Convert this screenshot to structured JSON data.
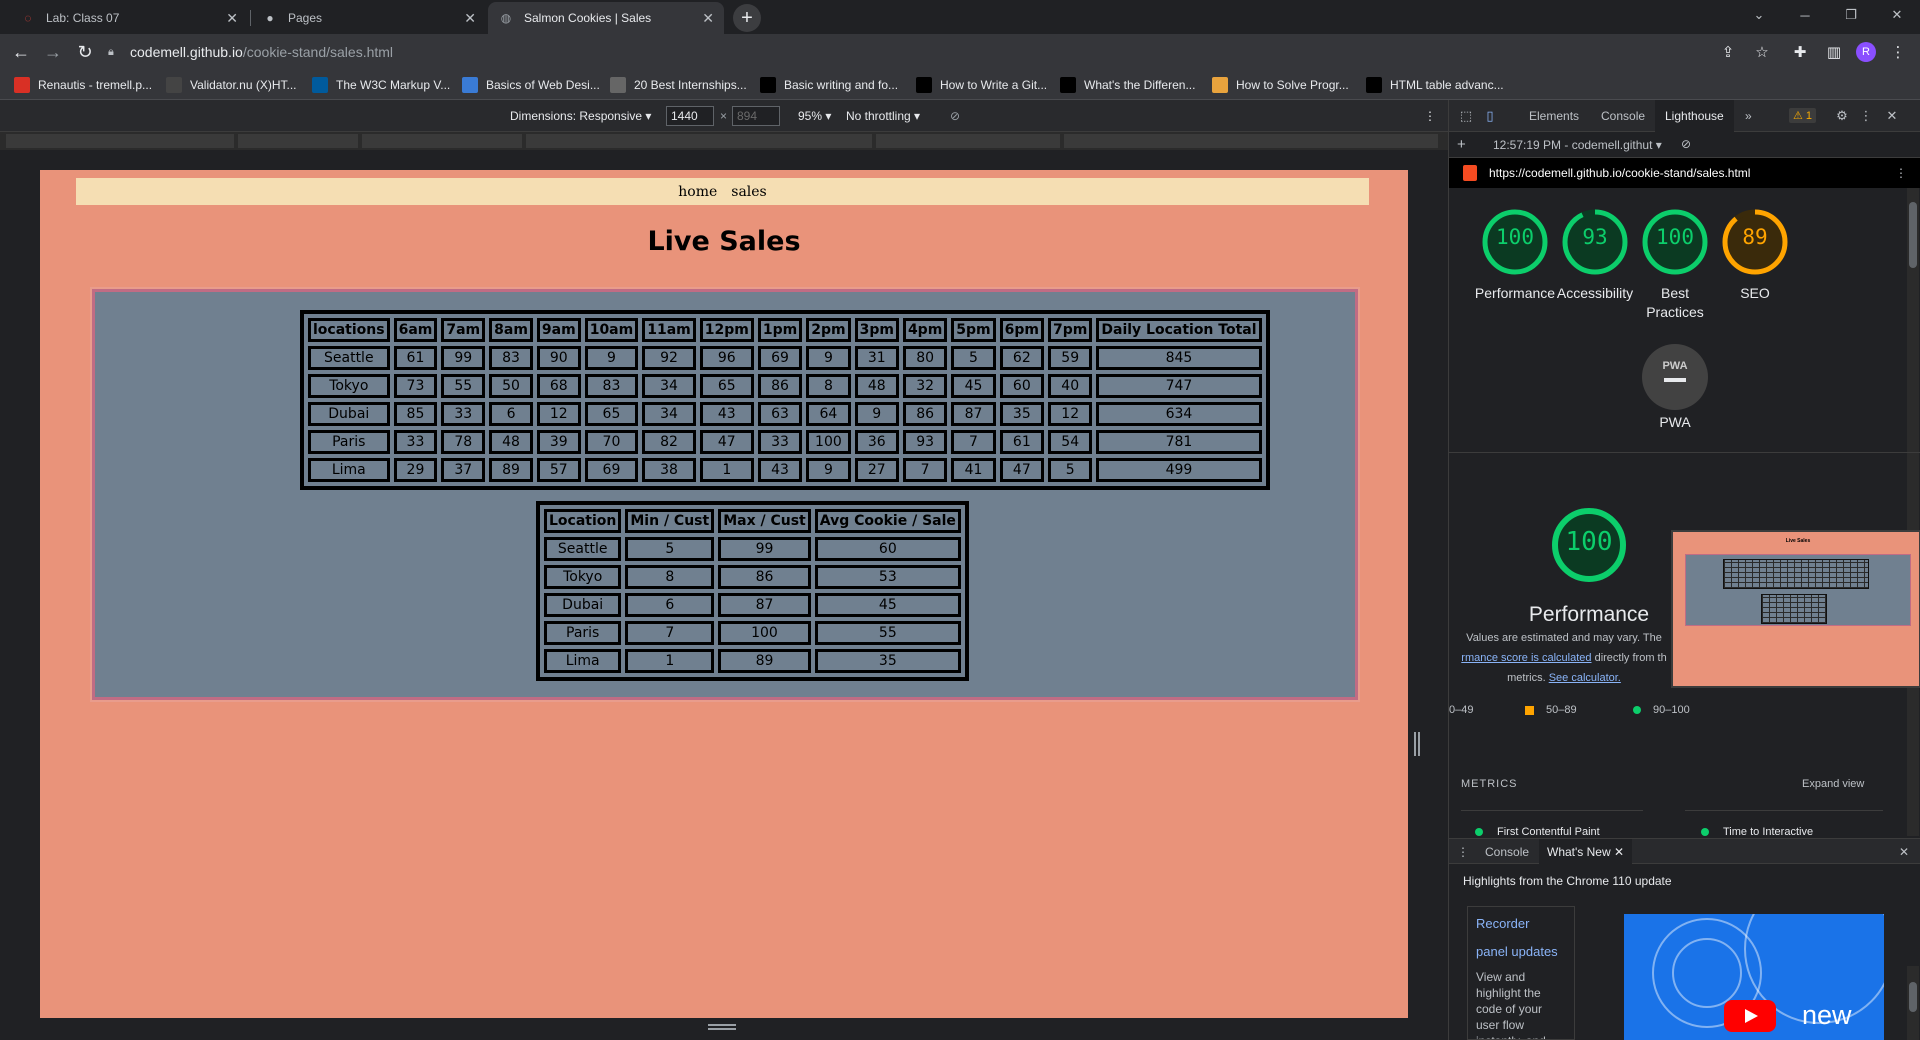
{
  "browser": {
    "tabs": [
      {
        "title": "Lab: Class 07",
        "icon": "codefellows-icon"
      },
      {
        "title": "Pages",
        "icon": "github-icon"
      },
      {
        "title": "Salmon Cookies | Sales",
        "icon": "globe-icon",
        "active": true
      }
    ],
    "url": {
      "host": "codemell.github.io",
      "path": "/cookie-stand/sales.html"
    },
    "profile_initial": "R",
    "bookmarks": [
      {
        "label": "Renautis - tremell.p...",
        "icon": "gmail-icon",
        "color": "#d93025"
      },
      {
        "label": "Validator.nu (X)HT...",
        "icon": "nu-icon",
        "color": "#444444"
      },
      {
        "label": "The W3C Markup V...",
        "icon": "w3c-icon",
        "color": "#005a9c"
      },
      {
        "label": "Basics of Web Desi...",
        "icon": "book-icon",
        "color": "#3a7bd5"
      },
      {
        "label": "20 Best Internships...",
        "icon": "internship-icon",
        "color": "#666666"
      },
      {
        "label": "Basic writing and fo...",
        "icon": "github-icon",
        "color": "#000000"
      },
      {
        "label": "How to Write a Git...",
        "icon": "copyright-icon",
        "color": "#000000"
      },
      {
        "label": "What's the Differen...",
        "icon": "medium-icon",
        "color": "#000000"
      },
      {
        "label": "How to Solve Progr...",
        "icon": "fcc-icon",
        "color": "#e8a33d"
      },
      {
        "label": "HTML table advanc...",
        "icon": "mdn-icon",
        "color": "#000000"
      }
    ]
  },
  "device_toolbar": {
    "dimensions_label": "Dimensions: Responsive",
    "width": "1440",
    "height_placeholder": "894",
    "times": "×",
    "zoom": "95%",
    "throttling": "No throttling"
  },
  "site": {
    "nav": [
      "home",
      "sales"
    ],
    "heading": "Live Sales",
    "sales_table": {
      "headers": [
        "locations",
        "6am",
        "7am",
        "8am",
        "9am",
        "10am",
        "11am",
        "12pm",
        "1pm",
        "2pm",
        "3pm",
        "4pm",
        "5pm",
        "6pm",
        "7pm",
        "Daily Location Total"
      ],
      "rows": [
        [
          "Seattle",
          "61",
          "99",
          "83",
          "90",
          "9",
          "92",
          "96",
          "69",
          "9",
          "31",
          "80",
          "5",
          "62",
          "59",
          "845"
        ],
        [
          "Tokyo",
          "73",
          "55",
          "50",
          "68",
          "83",
          "34",
          "65",
          "86",
          "8",
          "48",
          "32",
          "45",
          "60",
          "40",
          "747"
        ],
        [
          "Dubai",
          "85",
          "33",
          "6",
          "12",
          "65",
          "34",
          "43",
          "63",
          "64",
          "9",
          "86",
          "87",
          "35",
          "12",
          "634"
        ],
        [
          "Paris",
          "33",
          "78",
          "48",
          "39",
          "70",
          "82",
          "47",
          "33",
          "100",
          "36",
          "93",
          "7",
          "61",
          "54",
          "781"
        ],
        [
          "Lima",
          "29",
          "37",
          "89",
          "57",
          "69",
          "38",
          "1",
          "43",
          "9",
          "27",
          "7",
          "41",
          "47",
          "5",
          "499"
        ]
      ]
    },
    "stores_table": {
      "headers": [
        "Location",
        "Min / Cust",
        "Max / Cust",
        "Avg Cookie / Sale"
      ],
      "rows": [
        [
          "Seattle",
          "5",
          "99",
          "60"
        ],
        [
          "Tokyo",
          "8",
          "86",
          "53"
        ],
        [
          "Dubai",
          "6",
          "87",
          "45"
        ],
        [
          "Paris",
          "7",
          "100",
          "55"
        ],
        [
          "Lima",
          "1",
          "89",
          "35"
        ]
      ]
    }
  },
  "devtools": {
    "tabs": [
      "Elements",
      "Console",
      "Lighthouse"
    ],
    "active_tab": "Lighthouse",
    "warning_count": "1",
    "report_time": "12:57:19 PM - codemell.githut",
    "report_url": "https://codemell.github.io/cookie-stand/sales.html",
    "scores": [
      {
        "label": "Performance",
        "value": 100,
        "color": "#0cce6b"
      },
      {
        "label": "Accessibility",
        "value": 93,
        "color": "#0cce6b"
      },
      {
        "label": "Best Practices",
        "value": 100,
        "color": "#0cce6b"
      },
      {
        "label": "SEO",
        "value": 89,
        "color": "#ffa400"
      }
    ],
    "pwa_label": "PWA",
    "pwa_badge": "PWA",
    "big_score": {
      "label": "Performance",
      "value": 100
    },
    "perf_desc_1": "Values are estimated and may vary. The",
    "perf_desc_link": "rmance score is calculated",
    "perf_desc_2": "directly from th",
    "perf_desc_3": "metrics.",
    "perf_desc_link2": "See calculator.",
    "legend": [
      "0–49",
      "50–89",
      "90–100"
    ],
    "metrics_heading": "METRICS",
    "expand_view": "Expand view",
    "metrics": [
      "First Contentful Paint",
      "Time to Interactive"
    ],
    "drawer_tabs": [
      "Console",
      "What's New"
    ],
    "highlights": "Highlights from the Chrome 110 update",
    "whatsnew_card": {
      "title1": "Recorder",
      "title2": "panel updates",
      "body": "View and highlight the code of your user flow instantly, and"
    },
    "video_text": "new"
  }
}
